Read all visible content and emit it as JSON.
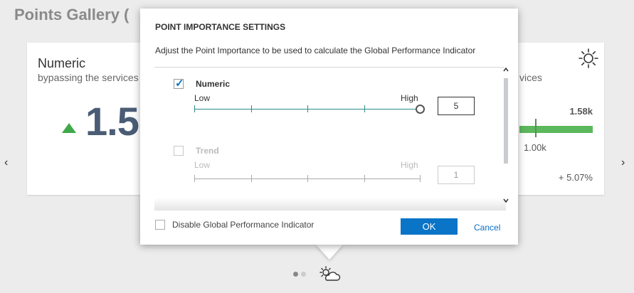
{
  "page": {
    "title": "Points Gallery ("
  },
  "card_left": {
    "title": "Numeric",
    "subtitle": "bypassing the services",
    "value": "1.5"
  },
  "card_right": {
    "subtitle": "vices",
    "max_value": "1.58k",
    "target_value": "1.00k",
    "change": "+ 5.07%"
  },
  "nav": {
    "prev": "‹",
    "next": "›"
  },
  "pager": {
    "page_count": 2,
    "active_page": 1
  },
  "dialog": {
    "title": "POINT IMPORTANCE SETTINGS",
    "description": "Adjust the Point Importance to be used to calculate the Global Performance Indicator",
    "items": [
      {
        "label": "Numeric",
        "checked": true,
        "low": "Low",
        "high": "High",
        "value": "5",
        "slider_level": 1.0
      },
      {
        "label": "Trend",
        "checked": false,
        "low": "Low",
        "high": "High",
        "value": "1",
        "slider_level": 0.0
      }
    ],
    "disable_label": "Disable Global Performance Indicator",
    "ok_label": "OK",
    "cancel_label": "Cancel"
  },
  "colors": {
    "accent": "#0a74c7",
    "slider_active": "#2f8a8a",
    "positive": "#3fa94a",
    "value_text": "#4a5d75"
  },
  "icons": [
    "sun-icon",
    "weather-cloud-sun-icon",
    "checkmark-icon",
    "chevron-up-icon",
    "chevron-down-icon",
    "chevron-left-icon",
    "chevron-right-icon"
  ]
}
